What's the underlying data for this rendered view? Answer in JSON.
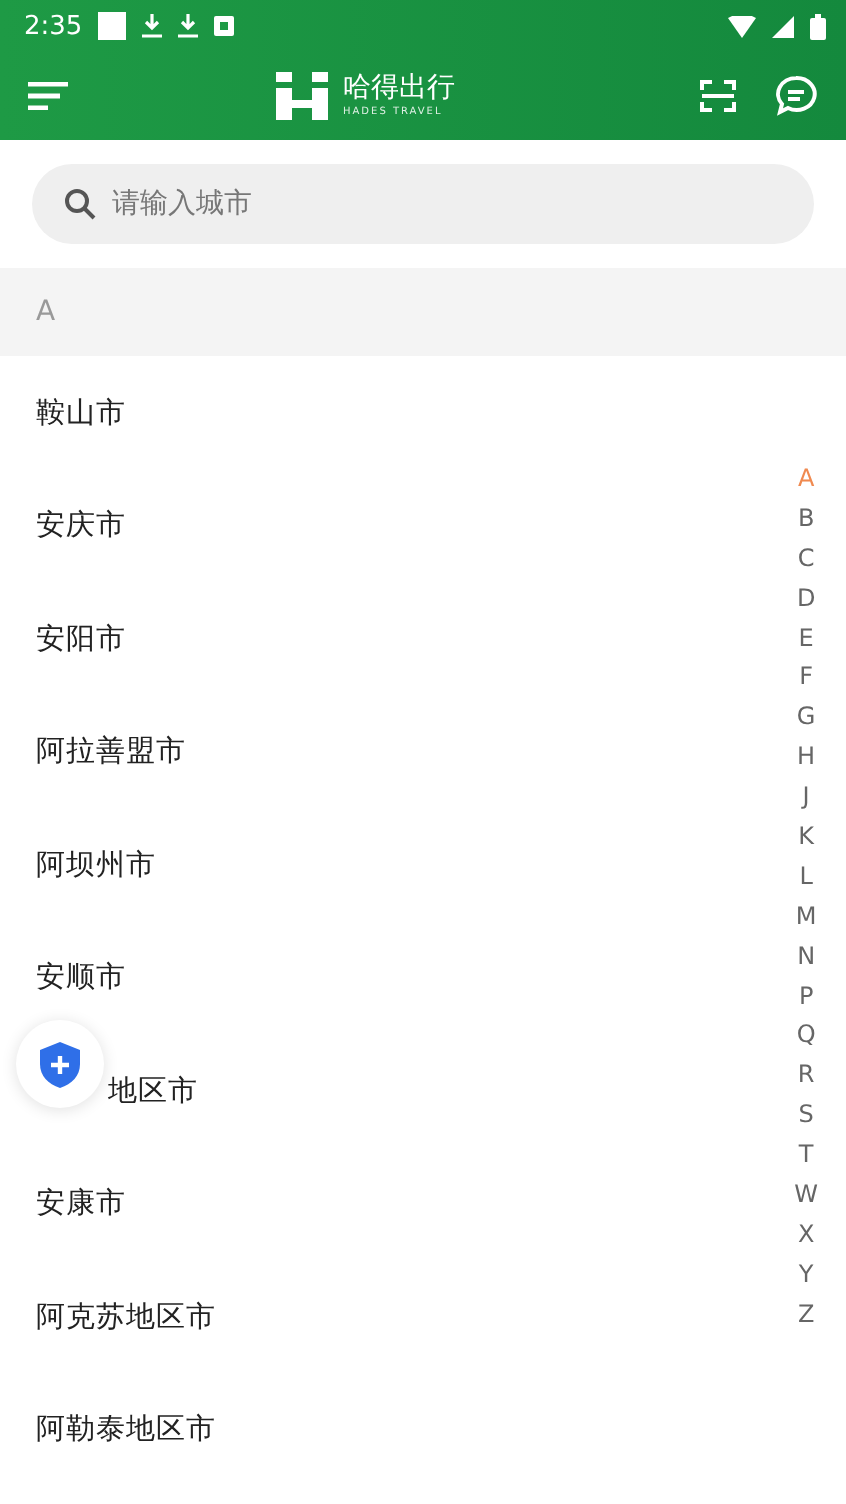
{
  "status_bar": {
    "time": "2:35"
  },
  "header": {
    "logo_title": "哈得出行",
    "logo_subtitle": "HADES TRAVEL"
  },
  "search": {
    "placeholder": "请输入城市"
  },
  "section": {
    "letter": "A"
  },
  "cities": [
    {
      "name": "鞍山市",
      "kind": "full"
    },
    {
      "name": "安庆市",
      "kind": "full"
    },
    {
      "name": "安阳市",
      "kind": "full"
    },
    {
      "name": "阿拉善盟市",
      "kind": "full"
    },
    {
      "name": "阿坝州市",
      "kind": "full"
    },
    {
      "name": "安顺市",
      "kind": "full"
    },
    {
      "name": "地区市",
      "kind": "partial"
    },
    {
      "name": "安康市",
      "kind": "full"
    },
    {
      "name": "阿克苏地区市",
      "kind": "full"
    },
    {
      "name": "阿勒泰地区市",
      "kind": "full"
    }
  ],
  "index": [
    {
      "letter": "A",
      "selected": true
    },
    {
      "letter": "B",
      "selected": false
    },
    {
      "letter": "C",
      "selected": false
    },
    {
      "letter": "D",
      "selected": false
    },
    {
      "letter": "E",
      "selected": false
    },
    {
      "letter": "F",
      "selected": false
    },
    {
      "letter": "G",
      "selected": false
    },
    {
      "letter": "H",
      "selected": false
    },
    {
      "letter": "J",
      "selected": false
    },
    {
      "letter": "K",
      "selected": false
    },
    {
      "letter": "L",
      "selected": false
    },
    {
      "letter": "M",
      "selected": false
    },
    {
      "letter": "N",
      "selected": false
    },
    {
      "letter": "P",
      "selected": false
    },
    {
      "letter": "Q",
      "selected": false
    },
    {
      "letter": "R",
      "selected": false
    },
    {
      "letter": "S",
      "selected": false
    },
    {
      "letter": "T",
      "selected": false
    },
    {
      "letter": "W",
      "selected": false
    },
    {
      "letter": "X",
      "selected": false
    },
    {
      "letter": "Y",
      "selected": false
    },
    {
      "letter": "Z",
      "selected": false
    }
  ]
}
